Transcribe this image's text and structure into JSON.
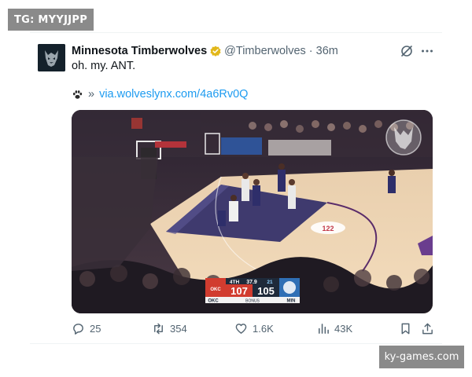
{
  "watermarks": {
    "top_left": "TG: MYYJJPP",
    "bottom_right": "ky-games.com"
  },
  "tweet": {
    "author_name": "Minnesota Timberwolves",
    "verified": true,
    "handle": "@Timberwolves",
    "separator": "·",
    "time_ago": "36m",
    "text": "oh. my. ANT.",
    "link_prefix_icon": "paw-emoji-icon",
    "link_chevron": "»",
    "link_text": "via.wolveslynx.com/4a6Rv0Q"
  },
  "media": {
    "alt": "video",
    "scoreboard": {
      "away_team": "OKC",
      "away_score": "107",
      "home_team": "MIN",
      "home_score": "105",
      "quarter": "4TH",
      "clock": "37.9",
      "shot_clock": "21",
      "bonus_label": "BONUS",
      "away_color": "#d13c2f",
      "home_color": "#2f6fb5"
    },
    "court_text": {
      "score_value": "122"
    }
  },
  "actions": {
    "replies": "25",
    "reposts": "354",
    "likes": "1.6K",
    "views": "43K"
  },
  "colors": {
    "accent": "#1d9bf0",
    "muted": "#536471",
    "verified_gold": "#e2b719"
  }
}
